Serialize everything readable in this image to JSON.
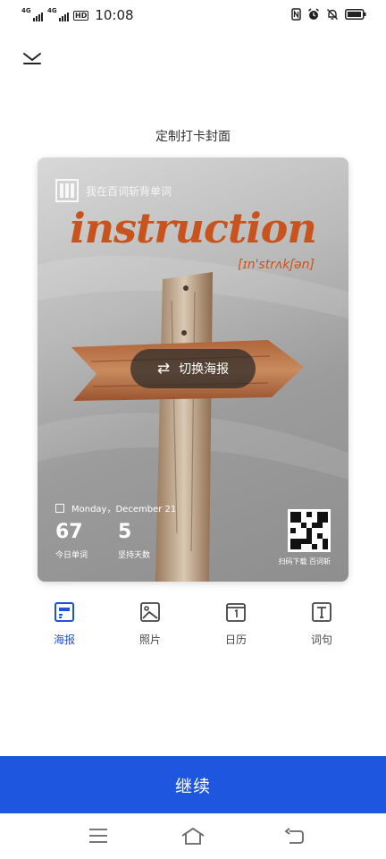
{
  "status_bar": {
    "net1": "4G",
    "net2": "4G",
    "hd": "HD",
    "time": "10:08"
  },
  "page": {
    "title": "定制打卡封面",
    "continue_label": "继续"
  },
  "poster": {
    "brand_name": "我在百词斩背单词",
    "word": "instruction",
    "phonetic": "[ɪn'strʌkʃən]",
    "switch_label": "切换海报",
    "switch_icon": "⇄",
    "date": "Monday，December 21",
    "today_words": "67",
    "today_words_label": "今日单词",
    "days": "5",
    "days_label": "坚持天数",
    "qr_label": "扫码下载 百词斩"
  },
  "tabs": [
    {
      "label": "海报",
      "icon": "poster-icon",
      "active": true
    },
    {
      "label": "照片",
      "icon": "photo-icon",
      "active": false
    },
    {
      "label": "日历",
      "icon": "calendar-icon",
      "active": false
    },
    {
      "label": "词句",
      "icon": "text-icon",
      "active": false
    }
  ],
  "colors": {
    "accent": "#1f56e0",
    "word": "#c8531c"
  }
}
